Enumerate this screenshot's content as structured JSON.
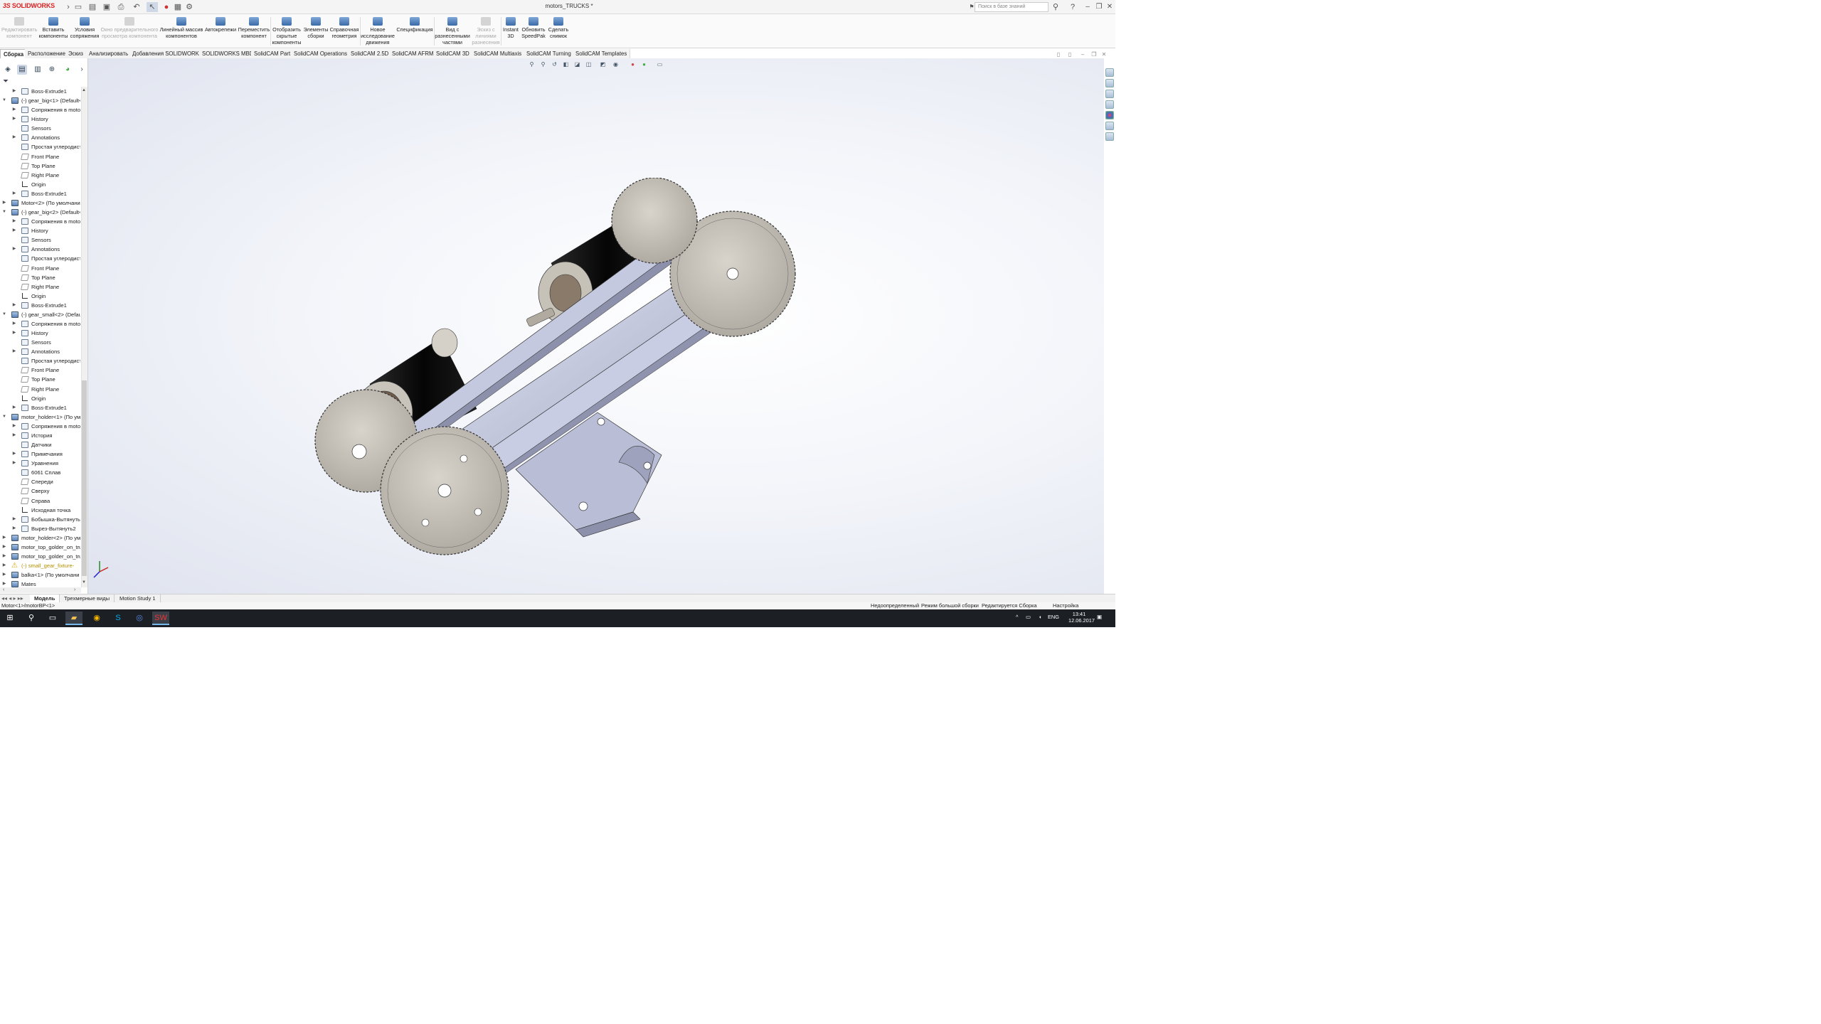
{
  "app": {
    "logo_text": "SOLIDWORKS",
    "logo_prefix": "3S",
    "window_title": "motors_TRUCKS *",
    "search_placeholder": "Поиск в базе знаний",
    "help_label": "?"
  },
  "ribbon": {
    "buttons": [
      {
        "label": "Редактировать компонент",
        "disabled": true
      },
      {
        "label": "Вставить компоненты",
        "disabled": false
      },
      {
        "label": "Условия сопряжения",
        "disabled": false
      },
      {
        "label": "Окно предварительного просмотра компонента",
        "disabled": true
      },
      {
        "label": "Линейный массив компонентов",
        "disabled": false
      },
      {
        "label": "Автокрепежи",
        "disabled": false
      },
      {
        "label": "Переместить компонент",
        "disabled": false
      },
      {
        "label": "Отобразить скрытые компоненты",
        "disabled": false
      },
      {
        "label": "Элементы сборки",
        "disabled": false
      },
      {
        "label": "Справочная геометрия",
        "disabled": false
      },
      {
        "label": "Новое исследование движения",
        "disabled": false
      },
      {
        "label": "Спецификация",
        "disabled": false
      },
      {
        "label": "Вид с разнесенными частями",
        "disabled": false
      },
      {
        "label": "Эскиз с линиями разнесения",
        "disabled": true
      },
      {
        "label": "Instant 3D",
        "disabled": false
      },
      {
        "label": "Обновить SpeedPak",
        "disabled": false
      },
      {
        "label": "Сделать снимок",
        "disabled": false
      }
    ]
  },
  "tabs": [
    {
      "label": "Сборка",
      "active": true
    },
    {
      "label": "Расположение",
      "active": false
    },
    {
      "label": "Эскиз",
      "active": false
    },
    {
      "label": "Анализировать",
      "active": false
    },
    {
      "label": "Добавления SOLIDWORKS",
      "active": false
    },
    {
      "label": "SOLIDWORKS MBD",
      "active": false
    },
    {
      "label": "SolidCAM Part",
      "active": false
    },
    {
      "label": "SolidCAM Operations",
      "active": false
    },
    {
      "label": "SolidCAM 2.5D",
      "active": false
    },
    {
      "label": "SolidCAM AFRM",
      "active": false
    },
    {
      "label": "SolidCAM 3D",
      "active": false
    },
    {
      "label": "SolidCAM Multiaxis",
      "active": false
    },
    {
      "label": "SolidCAM Turning",
      "active": false
    },
    {
      "label": "SolidCAM Templates",
      "active": false
    }
  ],
  "tree": [
    {
      "label": "Boss-Extrude1",
      "level": 2,
      "icon": "part",
      "arrow": true
    },
    {
      "label": "(-) gear_big<1> (Default<",
      "level": 1,
      "icon": "asm",
      "arrow": "down"
    },
    {
      "label": "Сопряжения в moto",
      "level": 2,
      "icon": "part",
      "arrow": true
    },
    {
      "label": "History",
      "level": 2,
      "icon": "part",
      "arrow": true
    },
    {
      "label": "Sensors",
      "level": 2,
      "icon": "part",
      "arrow": false
    },
    {
      "label": "Annotations",
      "level": 2,
      "icon": "part",
      "arrow": true
    },
    {
      "label": "Простая углеродиста",
      "level": 2,
      "icon": "part",
      "arrow": false
    },
    {
      "label": "Front Plane",
      "level": 2,
      "icon": "plane",
      "arrow": false
    },
    {
      "label": "Top Plane",
      "level": 2,
      "icon": "plane",
      "arrow": false
    },
    {
      "label": "Right Plane",
      "level": 2,
      "icon": "plane",
      "arrow": false
    },
    {
      "label": "Origin",
      "level": 2,
      "icon": "origin",
      "arrow": false
    },
    {
      "label": "Boss-Extrude1",
      "level": 2,
      "icon": "part",
      "arrow": true
    },
    {
      "label": "Motor<2> (По умолчани",
      "level": 1,
      "icon": "asm",
      "arrow": true
    },
    {
      "label": "(-) gear_big<2> (Default<",
      "level": 1,
      "icon": "asm",
      "arrow": "down"
    },
    {
      "label": "Сопряжения в moto",
      "level": 2,
      "icon": "part",
      "arrow": true
    },
    {
      "label": "History",
      "level": 2,
      "icon": "part",
      "arrow": true
    },
    {
      "label": "Sensors",
      "level": 2,
      "icon": "part",
      "arrow": false
    },
    {
      "label": "Annotations",
      "level": 2,
      "icon": "part",
      "arrow": true
    },
    {
      "label": "Простая углеродиста",
      "level": 2,
      "icon": "part",
      "arrow": false
    },
    {
      "label": "Front Plane",
      "level": 2,
      "icon": "plane",
      "arrow": false
    },
    {
      "label": "Top Plane",
      "level": 2,
      "icon": "plane",
      "arrow": false
    },
    {
      "label": "Right Plane",
      "level": 2,
      "icon": "plane",
      "arrow": false
    },
    {
      "label": "Origin",
      "level": 2,
      "icon": "origin",
      "arrow": false
    },
    {
      "label": "Boss-Extrude1",
      "level": 2,
      "icon": "part",
      "arrow": true
    },
    {
      "label": "(-) gear_small<2> (Default",
      "level": 1,
      "icon": "asm",
      "arrow": "down"
    },
    {
      "label": "Сопряжения в moto",
      "level": 2,
      "icon": "part",
      "arrow": true
    },
    {
      "label": "History",
      "level": 2,
      "icon": "part",
      "arrow": true
    },
    {
      "label": "Sensors",
      "level": 2,
      "icon": "part",
      "arrow": false
    },
    {
      "label": "Annotations",
      "level": 2,
      "icon": "part",
      "arrow": true
    },
    {
      "label": "Простая углеродиста",
      "level": 2,
      "icon": "part",
      "arrow": false
    },
    {
      "label": "Front Plane",
      "level": 2,
      "icon": "plane",
      "arrow": false
    },
    {
      "label": "Top Plane",
      "level": 2,
      "icon": "plane",
      "arrow": false
    },
    {
      "label": "Right Plane",
      "level": 2,
      "icon": "plane",
      "arrow": false
    },
    {
      "label": "Origin",
      "level": 2,
      "icon": "origin",
      "arrow": false
    },
    {
      "label": "Boss-Extrude1",
      "level": 2,
      "icon": "part",
      "arrow": true
    },
    {
      "label": "motor_holder<1> (По ум",
      "level": 1,
      "icon": "asm",
      "arrow": "down"
    },
    {
      "label": "Сопряжения в moto",
      "level": 2,
      "icon": "part",
      "arrow": true
    },
    {
      "label": "История",
      "level": 2,
      "icon": "part",
      "arrow": true
    },
    {
      "label": "Датчики",
      "level": 2,
      "icon": "part",
      "arrow": false
    },
    {
      "label": "Примечания",
      "level": 2,
      "icon": "part",
      "arrow": true
    },
    {
      "label": "Уравнения",
      "level": 2,
      "icon": "part",
      "arrow": true
    },
    {
      "label": "6061 Сплав",
      "level": 2,
      "icon": "part",
      "arrow": false
    },
    {
      "label": "Спереди",
      "level": 2,
      "icon": "plane",
      "arrow": false
    },
    {
      "label": "Сверху",
      "level": 2,
      "icon": "plane",
      "arrow": false
    },
    {
      "label": "Справа",
      "level": 2,
      "icon": "plane",
      "arrow": false
    },
    {
      "label": "Исходная точка",
      "level": 2,
      "icon": "origin",
      "arrow": false
    },
    {
      "label": "Бобышка-Вытянуть1",
      "level": 2,
      "icon": "part",
      "arrow": true
    },
    {
      "label": "Вырез-Вытянуть2",
      "level": 2,
      "icon": "part",
      "arrow": true
    },
    {
      "label": "motor_holder<2> (По ум",
      "level": 1,
      "icon": "asm",
      "arrow": true
    },
    {
      "label": "motor_top_golder_on_tru",
      "level": 1,
      "icon": "asm",
      "arrow": true
    },
    {
      "label": "motor_top_golder_on_tru",
      "level": 1,
      "icon": "asm",
      "arrow": true
    },
    {
      "label": "(-) small_gear_fixture-",
      "level": 1,
      "icon": "warn",
      "arrow": true
    },
    {
      "label": "balka<1> (По умолчани",
      "level": 1,
      "icon": "asm",
      "arrow": true
    },
    {
      "label": "Mates",
      "level": 1,
      "icon": "asm",
      "arrow": true
    }
  ],
  "bottom_tabs": [
    {
      "label": "Модель",
      "active": true
    },
    {
      "label": "Трехмерные виды",
      "active": false
    },
    {
      "label": "Motion Study 1",
      "active": false
    }
  ],
  "status": {
    "path": "Motor<1>/motorBP<1>",
    "underdefined": "Недоопределенный",
    "large_assembly": "Режим большой сборки",
    "editing": "Редактируется Сборка",
    "settings": "Настройка"
  },
  "taskbar": {
    "time": "13:41",
    "date": "12.06.2017",
    "lang": "ENG"
  },
  "colors": {
    "accent": "#d22222",
    "gear": "#c9c4bc",
    "frame": "#c7cbe0",
    "motor": "#0e0e0e"
  }
}
